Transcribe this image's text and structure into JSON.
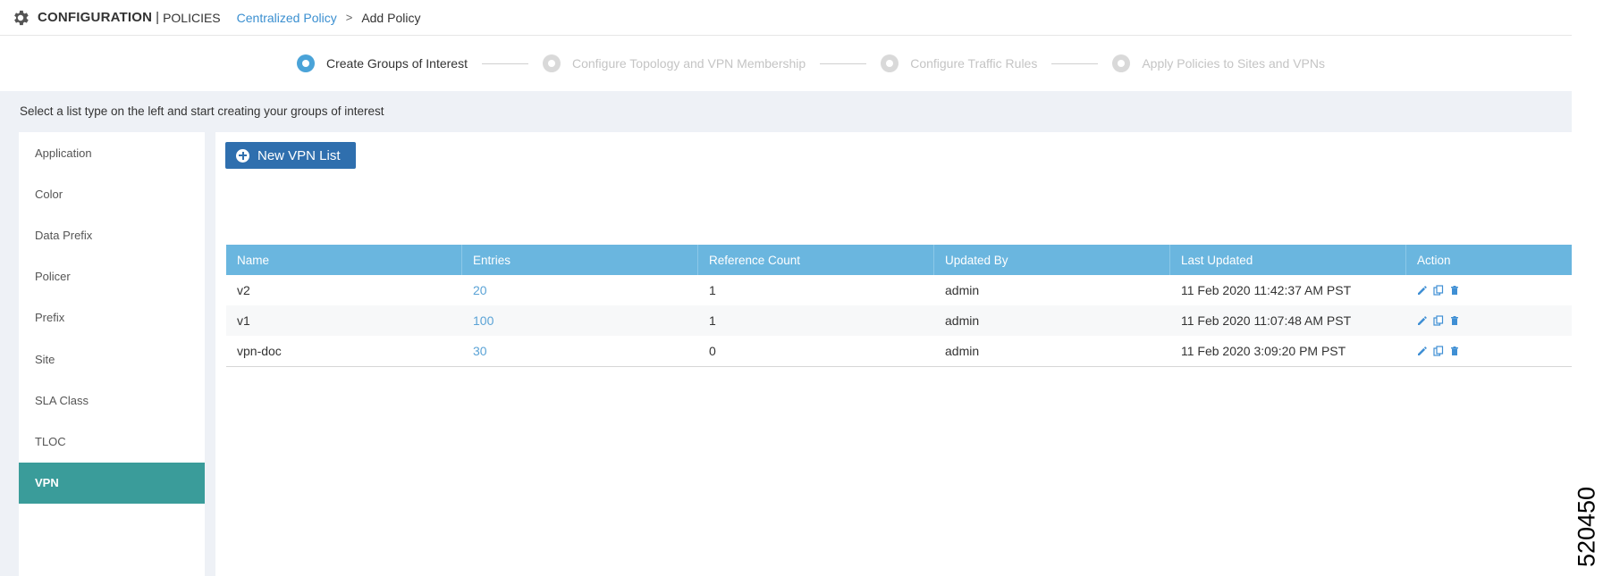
{
  "header": {
    "title": "CONFIGURATION",
    "separator": "|",
    "subtitle": "POLICIES",
    "breadcrumb_link": "Centralized Policy",
    "breadcrumb_arrow": ">",
    "breadcrumb_current": "Add Policy"
  },
  "stepper": {
    "steps": [
      {
        "label": "Create Groups of Interest",
        "state": "active"
      },
      {
        "label": "Configure Topology and VPN Membership",
        "state": "inactive"
      },
      {
        "label": "Configure Traffic Rules",
        "state": "inactive"
      },
      {
        "label": "Apply Policies to Sites and VPNs",
        "state": "inactive"
      }
    ]
  },
  "instruction": "Select a list type on the left and start creating your groups of interest",
  "sidebar": {
    "items": [
      {
        "label": "Application"
      },
      {
        "label": "Color"
      },
      {
        "label": "Data Prefix"
      },
      {
        "label": "Policer"
      },
      {
        "label": "Prefix"
      },
      {
        "label": "Site"
      },
      {
        "label": "SLA Class"
      },
      {
        "label": "TLOC"
      },
      {
        "label": "VPN"
      }
    ],
    "active": "VPN"
  },
  "main": {
    "new_button_label": "New VPN List",
    "table": {
      "columns": [
        "Name",
        "Entries",
        "Reference Count",
        "Updated By",
        "Last Updated",
        "Action"
      ],
      "rows": [
        {
          "name": "v2",
          "entries": "20",
          "reference_count": "1",
          "updated_by": "admin",
          "last_updated": "11 Feb 2020 11:42:37 AM PST"
        },
        {
          "name": "v1",
          "entries": "100",
          "reference_count": "1",
          "updated_by": "admin",
          "last_updated": "11 Feb 2020 11:07:48 AM PST"
        },
        {
          "name": "vpn-doc",
          "entries": "30",
          "reference_count": "0",
          "updated_by": "admin",
          "last_updated": "11 Feb 2020 3:09:20 PM PST"
        }
      ]
    }
  },
  "figure_id": "520450",
  "icons": {
    "header": "gear-icon",
    "new_button": "plus-circle-icon",
    "row_actions": [
      "pencil-icon",
      "copy-icon",
      "trash-icon"
    ]
  },
  "colors": {
    "accent": "#4aa3d8",
    "table_header": "#6ab6df",
    "active_sidebar": "#3a9c9a",
    "primary_button": "#2f6fae",
    "link": "#5ba3d6",
    "action_icon": "#3f8fd4"
  }
}
